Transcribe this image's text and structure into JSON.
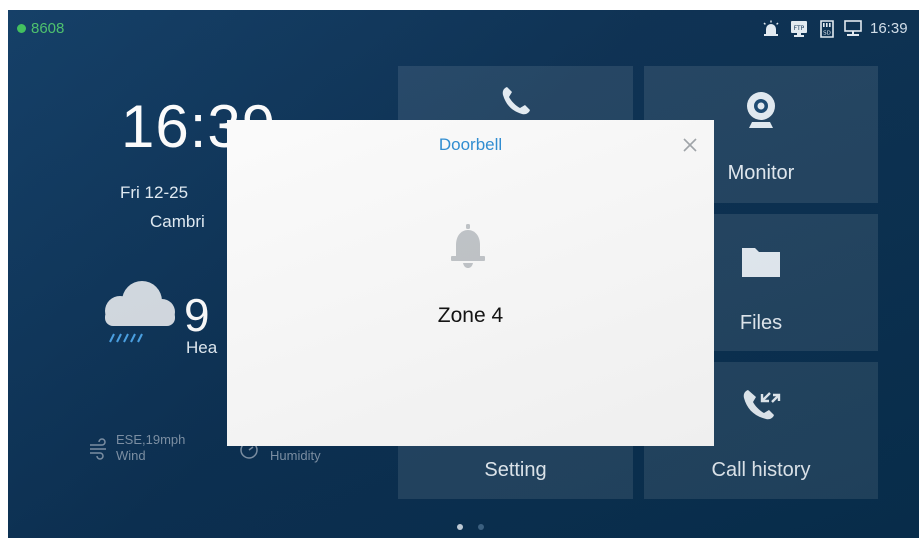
{
  "statusbar": {
    "extension": "8608",
    "time": "16:39",
    "icons": [
      "alarm-icon",
      "ftp-icon",
      "sd-card-icon",
      "network-icon"
    ]
  },
  "home": {
    "time": "16:39",
    "date": "Fri 12-25",
    "city": "Cambri",
    "temperature": "9",
    "weather_desc": "Hea",
    "wind_value": "ESE,19mph",
    "wind_label": "Wind",
    "humidity_label": "Humidity"
  },
  "tiles": {
    "monitor": "Monitor",
    "files": "Files",
    "setting": "Setting",
    "call_history": "Call history"
  },
  "pager": {
    "count": 2,
    "active": 1
  },
  "dialog": {
    "title": "Doorbell",
    "message": "Zone 4"
  },
  "colors": {
    "accent": "#2e8fd6",
    "online": "#3dbf5a",
    "background": "#0a2f52"
  }
}
